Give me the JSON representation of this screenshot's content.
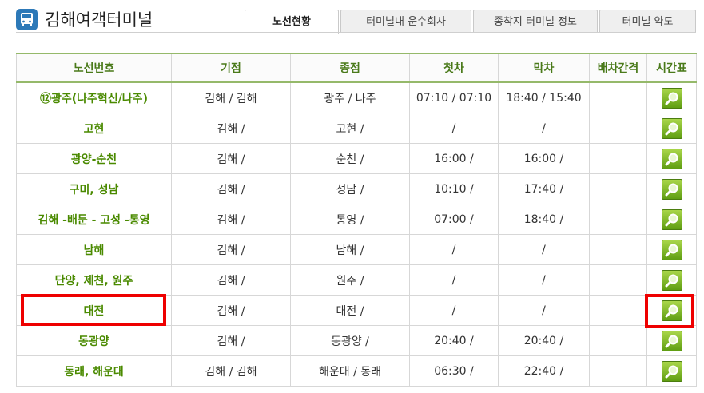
{
  "app": {
    "title": "김해여객터미널",
    "logo_icon": "bus-icon"
  },
  "tabs": [
    {
      "label": "노선현황",
      "active": true
    },
    {
      "label": "터미널내 운수회사",
      "active": false
    },
    {
      "label": "종착지 터미널 정보",
      "active": false
    },
    {
      "label": "터미널 약도",
      "active": false
    }
  ],
  "table": {
    "headers": [
      "노선번호",
      "기점",
      "종점",
      "첫차",
      "막차",
      "배차간격",
      "시간표"
    ],
    "rows": [
      {
        "route": "⑫광주(나주혁신/나주)",
        "origin": "김해 / 김해",
        "dest": "광주 / 나주",
        "first": "07:10 / 07:10",
        "last": "18:40 / 15:40",
        "interval": "",
        "timetable_icon": "magnifier-icon"
      },
      {
        "route": "고현",
        "origin": "김해 /",
        "dest": "고현 /",
        "first": "/",
        "last": "/",
        "interval": "",
        "timetable_icon": "magnifier-icon"
      },
      {
        "route": "광양-순천",
        "origin": "김해 /",
        "dest": "순천 /",
        "first": "16:00 /",
        "last": "16:00 /",
        "interval": "",
        "timetable_icon": "magnifier-icon"
      },
      {
        "route": "구미, 성남",
        "origin": "김해 /",
        "dest": "성남 /",
        "first": "10:10 /",
        "last": "17:40 /",
        "interval": "",
        "timetable_icon": "magnifier-icon"
      },
      {
        "route": "김해 -배둔 - 고성 -통영",
        "origin": "김해 /",
        "dest": "통영 /",
        "first": "07:00 /",
        "last": "18:40 /",
        "interval": "",
        "timetable_icon": "magnifier-icon"
      },
      {
        "route": "남해",
        "origin": "김해 /",
        "dest": "남해 /",
        "first": "/",
        "last": "/",
        "interval": "",
        "timetable_icon": "magnifier-icon"
      },
      {
        "route": "단양, 제천, 원주",
        "origin": "김해 /",
        "dest": "원주 /",
        "first": "/",
        "last": "/",
        "interval": "",
        "timetable_icon": "magnifier-icon"
      },
      {
        "route": "대전",
        "origin": "김해 /",
        "dest": "대전 /",
        "first": "/",
        "last": "/",
        "interval": "",
        "timetable_icon": "magnifier-icon"
      },
      {
        "route": "동광양",
        "origin": "김해 /",
        "dest": "동광양 /",
        "first": "20:40 /",
        "last": "20:40 /",
        "interval": "",
        "timetable_icon": "magnifier-icon"
      },
      {
        "route": "동래, 해운대",
        "origin": "김해 / 김해",
        "dest": "해운대 / 동래",
        "first": "06:30 /",
        "last": "22:40 /",
        "interval": "",
        "timetable_icon": "magnifier-icon"
      }
    ]
  },
  "highlight": {
    "row": "대전",
    "color": "#ee0000"
  }
}
